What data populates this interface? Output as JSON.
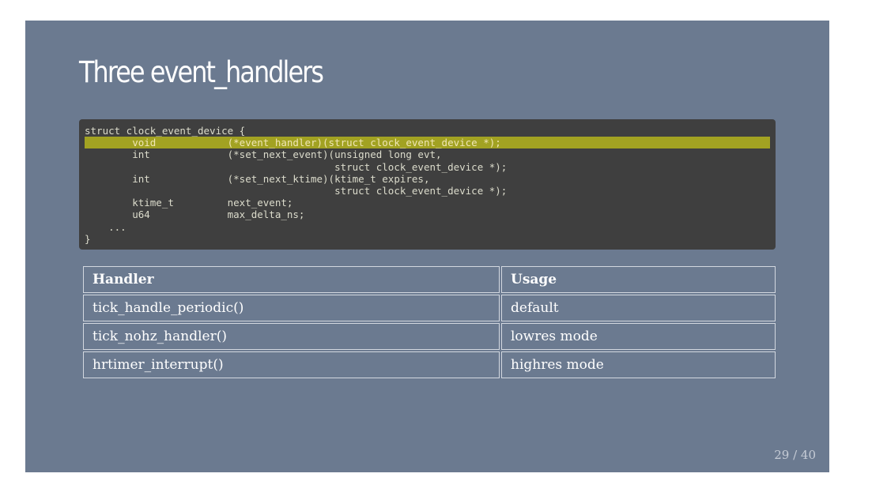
{
  "slide": {
    "title": "Three event_handlers",
    "code_lines": [
      "struct clock_event_device {",
      "        void            (*event_handler)(struct clock_event_device *);",
      "        int             (*set_next_event)(unsigned long evt,",
      "                                          struct clock_event_device *);",
      "        int             (*set_next_ktime)(ktime_t expires,",
      "                                          struct clock_event_device *);",
      "        ktime_t         next_event;",
      "        u64             max_delta_ns;",
      "    ...",
      "}"
    ],
    "highlighted_line_index": 1,
    "table": {
      "headers": [
        "Handler",
        "Usage"
      ],
      "rows": [
        [
          "tick_handle_periodic()",
          "default"
        ],
        [
          "tick_nohz_handler()",
          "lowres mode"
        ],
        [
          "hrtimer_interrupt()",
          "highres mode"
        ]
      ]
    },
    "page_number": "29 / 40"
  },
  "colors": {
    "slide_background": "#6b7a90",
    "code_background": "#3f3f3f",
    "highlight": "#a2a222"
  }
}
